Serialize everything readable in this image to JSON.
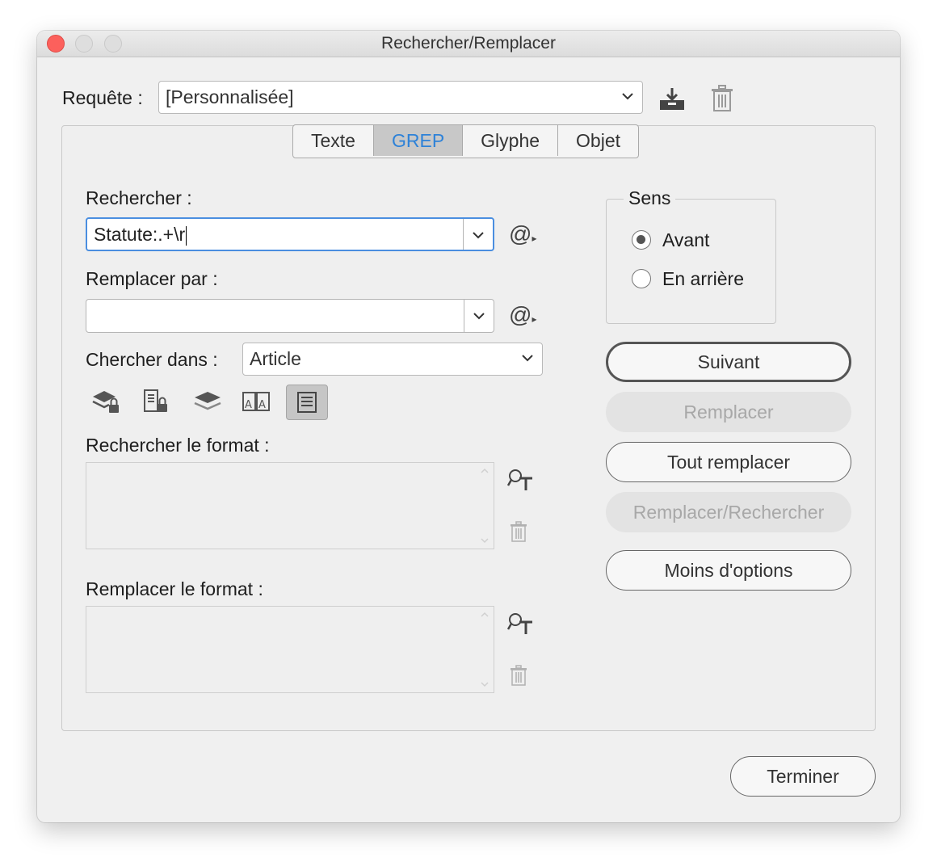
{
  "window": {
    "title": "Rechercher/Remplacer"
  },
  "query": {
    "label": "Requête :",
    "value": "[Personnalisée]",
    "icons": [
      "save-query-icon",
      "delete-query-icon"
    ]
  },
  "tabs": [
    {
      "label": "Texte",
      "active": false
    },
    {
      "label": "GREP",
      "active": true
    },
    {
      "label": "Glyphe",
      "active": false
    },
    {
      "label": "Objet",
      "active": false
    }
  ],
  "find": {
    "label": "Rechercher :",
    "value": "Statute:.+\\r",
    "special_icon": "at-special-characters-icon"
  },
  "replace": {
    "label": "Remplacer par :",
    "value": "",
    "special_icon": "at-special-characters-icon"
  },
  "search_in": {
    "label": "Chercher dans :",
    "value": "Article"
  },
  "scope_icons": [
    "locked-layers-icon",
    "locked-stories-icon",
    "hidden-layers-icon",
    "master-pages-icon",
    "footnotes-icon"
  ],
  "find_format": {
    "label": "Rechercher le format :"
  },
  "replace_format": {
    "label": "Remplacer le format :"
  },
  "direction": {
    "legend": "Sens",
    "options": [
      {
        "label": "Avant",
        "selected": true
      },
      {
        "label": "En arrière",
        "selected": false
      }
    ]
  },
  "buttons": {
    "next": "Suivant",
    "replace": "Remplacer",
    "replace_all": "Tout remplacer",
    "replace_find": "Remplacer/Rechercher",
    "fewer_options": "Moins d'options",
    "done": "Terminer"
  },
  "colors": {
    "accent": "#2e82d8",
    "close": "#fc605c",
    "focus": "#4a8ee0"
  }
}
